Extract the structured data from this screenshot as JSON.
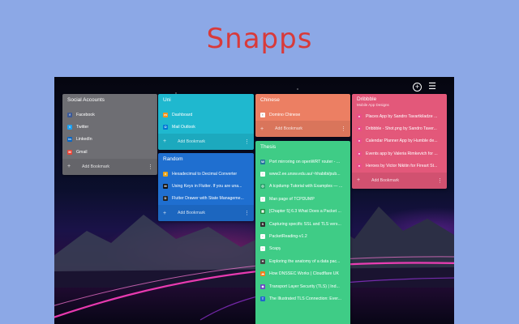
{
  "hero_title": "Snapps",
  "topbar": {
    "add_icon": "plus-circle-icon",
    "settings_icon": "sliders-icon"
  },
  "boards": {
    "social": {
      "title": "Social Accounts",
      "color": "#6e6e73",
      "items": [
        {
          "label": "Facebook",
          "icon": "facebook-icon",
          "icon_color": "#3b5998",
          "glyph": "f"
        },
        {
          "label": "Twitter",
          "icon": "twitter-icon",
          "icon_color": "#1da1f2",
          "glyph": "t"
        },
        {
          "label": "LinkedIn",
          "icon": "linkedin-icon",
          "icon_color": "#0a66c2",
          "glyph": "in"
        },
        {
          "label": "Gmail",
          "icon": "gmail-icon",
          "icon_color": "#ea4335",
          "glyph": "M"
        }
      ],
      "add_label": "Add Bookmark"
    },
    "uni": {
      "title": "Uni",
      "color": "#1fb8cf",
      "items": [
        {
          "label": "Dashboard",
          "icon": "moodle-icon",
          "icon_color": "#f7931e",
          "glyph": "m"
        },
        {
          "label": "Mail Outlook",
          "icon": "outlook-icon",
          "icon_color": "#0078d4",
          "glyph": "O"
        }
      ],
      "add_label": "Add Bookmark"
    },
    "random": {
      "title": "Random",
      "color": "#1f6fd0",
      "items": [
        {
          "label": "Hexadecimal to Decimal Converter",
          "icon": "converter-icon",
          "icon_color": "#e8a317",
          "glyph": "#"
        },
        {
          "label": "Using Keys in Flutter. If you are una...",
          "icon": "medium-icon",
          "icon_color": "#111111",
          "glyph": "M"
        },
        {
          "label": "Flutter Drawer with State Manageme...",
          "icon": "dev-icon",
          "icon_color": "#222222",
          "glyph": "D"
        }
      ],
      "add_label": "Add Bookmark"
    },
    "chinese": {
      "title": "Chinese",
      "color": "#ec7f63",
      "items": [
        {
          "label": "Domino Chinese",
          "icon": "domino-icon",
          "icon_color": "#ffffff",
          "glyph": "▪"
        }
      ],
      "add_label": "Add Bookmark"
    },
    "thesis": {
      "title": "Thesis",
      "color": "#3fcc86",
      "items": [
        {
          "label": "Port mirroring on openWRT router - ...",
          "icon": "wordpress-icon",
          "icon_color": "#21759b",
          "glyph": "W"
        },
        {
          "label": "www2.ee.unsw.edu.au/~hhabibi/pub...",
          "icon": "doc-icon",
          "icon_color": "#ffffff",
          "glyph": "▫"
        },
        {
          "label": "A tcpdump Tutorial with Examples — ...",
          "icon": "globe-icon",
          "icon_color": "#2aa36b",
          "glyph": "◎"
        },
        {
          "label": "Man page of TCPDUMP",
          "icon": "doc-icon",
          "icon_color": "#ffffff",
          "glyph": "▫"
        },
        {
          "label": "[Chapter 5] 6.3 What Does a Packet ...",
          "icon": "book-icon",
          "icon_color": "#1d8a3d",
          "glyph": "▦"
        },
        {
          "label": "Capturing specific SSL and TLS vers...",
          "icon": "stackexchange-icon",
          "icon_color": "#2f2f2f",
          "glyph": "S"
        },
        {
          "label": "PacketReading-v1.2",
          "icon": "doc-icon",
          "icon_color": "#ffffff",
          "glyph": "▫"
        },
        {
          "label": "Scapy",
          "icon": "doc-icon",
          "icon_color": "#ffffff",
          "glyph": "▫"
        },
        {
          "label": "Exploring the anatomy of a data pac...",
          "icon": "tech-icon",
          "icon_color": "#444444",
          "glyph": "✦"
        },
        {
          "label": "How DNSSEC Works | Cloudflare UK",
          "icon": "cloudflare-icon",
          "icon_color": "#f38020",
          "glyph": "☁"
        },
        {
          "label": "Transport Layer Security (TLS) | Ind...",
          "icon": "shield-icon",
          "icon_color": "#6a4bc4",
          "glyph": "◆"
        },
        {
          "label": "The Illustrated TLS Connection: Ever...",
          "icon": "tls-icon",
          "icon_color": "#2266cc",
          "glyph": "T"
        }
      ]
    },
    "dribbble": {
      "title": "Dribbble",
      "subtitle": "Mobile App Designs",
      "color": "#e3587a",
      "items": [
        {
          "label": "Places App by Sandro Tavartkiladze ...",
          "icon": "dribbble-icon",
          "icon_color": "#ea4c89",
          "glyph": "●"
        },
        {
          "label": "Dribbble - Shot.png by Sandro Taver...",
          "icon": "dribbble-icon",
          "icon_color": "#ea4c89",
          "glyph": "●"
        },
        {
          "label": "Calendar Planner App by Humble de...",
          "icon": "dribbble-icon",
          "icon_color": "#ea4c89",
          "glyph": "●"
        },
        {
          "label": "Events app by Valeria Rimkevich for ...",
          "icon": "dribbble-icon",
          "icon_color": "#ea4c89",
          "glyph": "●"
        },
        {
          "label": "Heroes by Victor Nikitin for Fireart St...",
          "icon": "dribbble-icon",
          "icon_color": "#ea4c89",
          "glyph": "●"
        }
      ],
      "add_label": "Add Bookmark"
    }
  }
}
